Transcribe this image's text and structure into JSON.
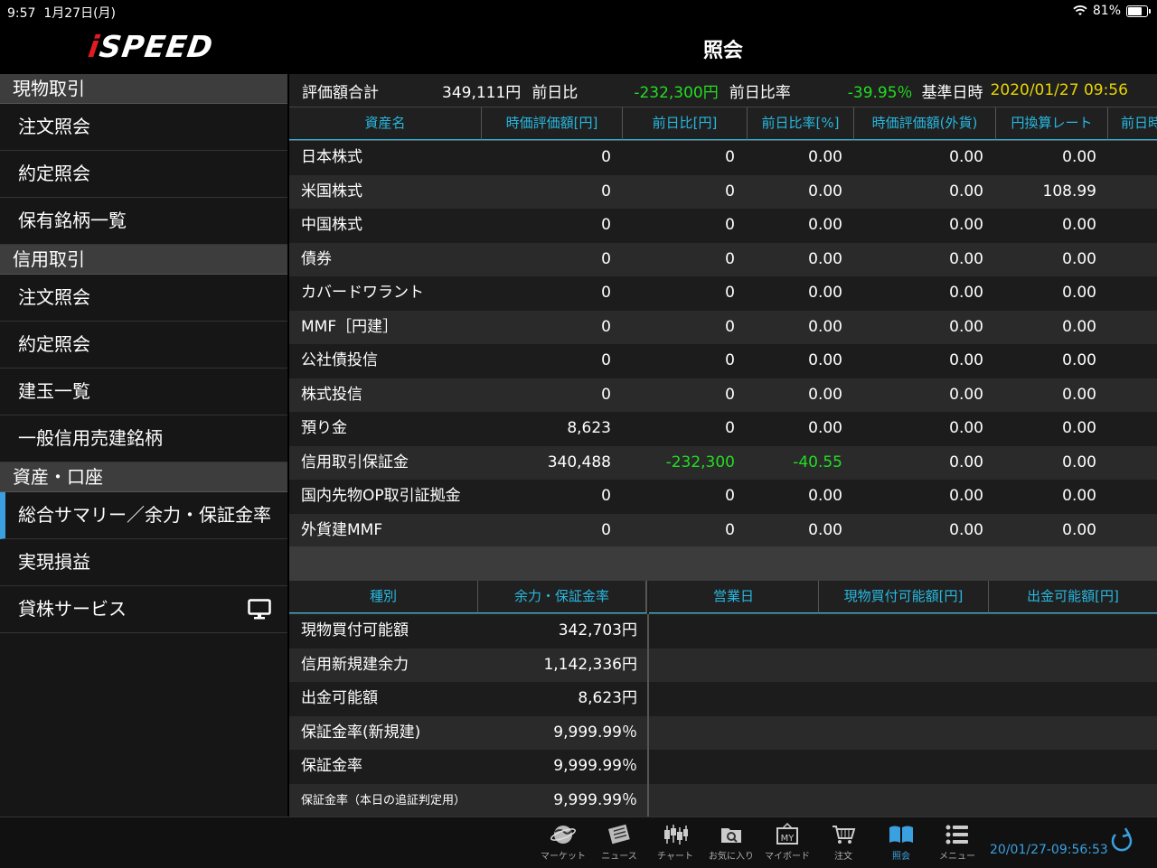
{
  "status_bar": {
    "time": "9:57",
    "date": "1月27日(月)",
    "battery": "81%",
    "battery_level": 0.81
  },
  "header": {
    "logo_prefix": "i",
    "logo_rest": "SPEED",
    "title": "照会"
  },
  "sidebar": {
    "sections": [
      {
        "title": "現物取引",
        "items": [
          "注文照会",
          "約定照会",
          "保有銘柄一覧"
        ]
      },
      {
        "title": "信用取引",
        "items": [
          "注文照会",
          "約定照会",
          "建玉一覧",
          "一般信用売建銘柄"
        ]
      },
      {
        "title": "資産・口座",
        "items": [
          "総合サマリー／余力・保証金率",
          "実現損益",
          "貸株サービス"
        ]
      }
    ]
  },
  "summary": {
    "valuation_label": "評価額合計",
    "valuation_value": "349,111円",
    "change_label": "前日比",
    "change_value": "-232,300円",
    "change_rate_label": "前日比率",
    "change_rate_value": "-39.95％",
    "base_time_label": "基準日時",
    "base_time_value": "2020/01/27 09:56"
  },
  "asset_table": {
    "headers": [
      "資産名",
      "時価評価額[円]",
      "前日比[円]",
      "前日比率[%]",
      "時価評価額(外貨)",
      "円換算レート",
      "前日時"
    ],
    "rows": [
      [
        "日本株式",
        "0",
        "0",
        "0.00",
        "0.00",
        "0.00"
      ],
      [
        "米国株式",
        "0",
        "0",
        "0.00",
        "0.00",
        "108.99"
      ],
      [
        "中国株式",
        "0",
        "0",
        "0.00",
        "0.00",
        "0.00"
      ],
      [
        "債券",
        "0",
        "0",
        "0.00",
        "0.00",
        "0.00"
      ],
      [
        "カバードワラント",
        "0",
        "0",
        "0.00",
        "0.00",
        "0.00"
      ],
      [
        "MMF［円建］",
        "0",
        "0",
        "0.00",
        "0.00",
        "0.00"
      ],
      [
        "公社債投信",
        "0",
        "0",
        "0.00",
        "0.00",
        "0.00"
      ],
      [
        "株式投信",
        "0",
        "0",
        "0.00",
        "0.00",
        "0.00"
      ],
      [
        "預り金",
        "8,623",
        "0",
        "0.00",
        "0.00",
        "0.00"
      ],
      [
        "信用取引保証金",
        "340,488",
        "-232,300",
        "-40.55",
        "0.00",
        "0.00"
      ],
      [
        "国内先物OP取引証拠金",
        "0",
        "0",
        "0.00",
        "0.00",
        "0.00"
      ],
      [
        "外貨建MMF",
        "0",
        "0",
        "0.00",
        "0.00",
        "0.00"
      ]
    ]
  },
  "margin_table": {
    "headers": [
      "種別",
      "余力・保証金率"
    ],
    "rows": [
      [
        "現物買付可能額",
        "342,703円"
      ],
      [
        "信用新規建余力",
        "1,142,336円"
      ],
      [
        "出金可能額",
        "8,623円"
      ],
      [
        "保証金率(新規建)",
        "9,999.99％"
      ],
      [
        "保証金率",
        "9,999.99％"
      ],
      [
        "保証金率（本日の追証判定用）",
        "9,999.99％"
      ]
    ]
  },
  "schedule_table": {
    "headers": [
      "営業日",
      "現物買付可能額[円]",
      "出金可能額[円]"
    ]
  },
  "tabbar": {
    "tabs": [
      {
        "label": "マーケット",
        "icon": "globe-icon"
      },
      {
        "label": "ニュース",
        "icon": "newspaper-icon"
      },
      {
        "label": "チャート",
        "icon": "candlestick-icon"
      },
      {
        "label": "お気に入り",
        "icon": "folder-search-icon"
      },
      {
        "label": "マイボード",
        "icon": "my-board-icon"
      },
      {
        "label": "注文",
        "icon": "cart-icon"
      },
      {
        "label": "照会",
        "icon": "book-icon"
      },
      {
        "label": "メニュー",
        "icon": "list-icon"
      }
    ],
    "active": "照会",
    "clock": "20/01/27-09:56:53"
  },
  "colors": {
    "accent": "#3aa0e0",
    "header_text": "#27b8e0",
    "positive": "#22dd22",
    "date": "#e8d400",
    "logo_i": "#e21b22"
  }
}
